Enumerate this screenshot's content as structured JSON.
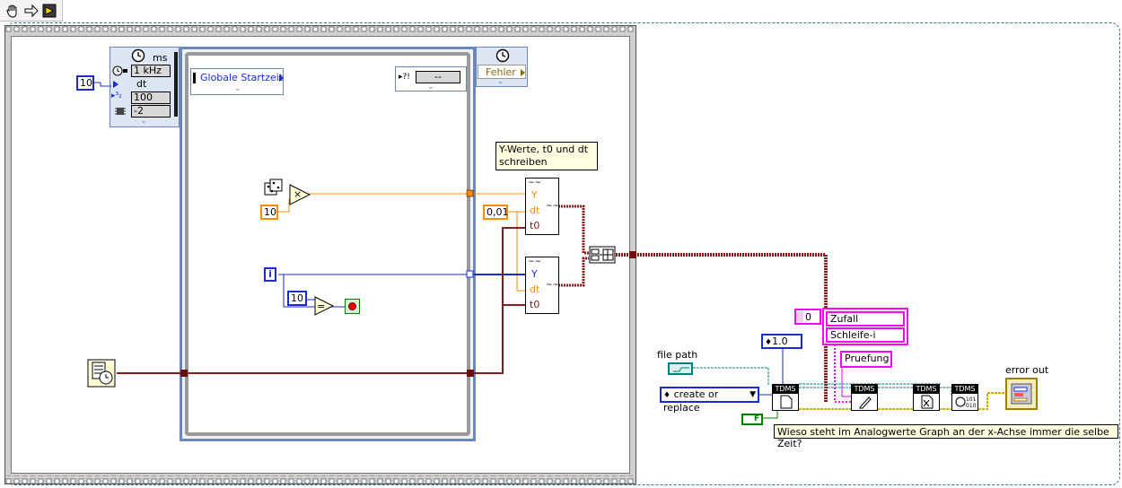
{
  "toolbar": {
    "icons": [
      "hand-icon",
      "arrow-icon",
      "probe-icon"
    ]
  },
  "timed_struct": {
    "unit": "ms",
    "source": "1 kHz",
    "dt_label": "dt",
    "dt_value": "10",
    "offset": "100",
    "processor": "-2"
  },
  "frames": {
    "global_start": "Globale Startzeit",
    "dash": "--",
    "error_label": "Fehler"
  },
  "constants": {
    "ten_mult": "10",
    "ten_compare": "10",
    "dt_const": "0,01",
    "zero_index": "0",
    "version": "1.0",
    "false_const": "F",
    "iteration": "i"
  },
  "waveform": {
    "y": "Y",
    "dt": "dt",
    "t0": "t0"
  },
  "channels": [
    "Zufall",
    "Schleife-i"
  ],
  "group_name": "Pruefung",
  "file_path_label": "file path",
  "operation": "create or replace",
  "error_out_label": "error out",
  "tdms": {
    "open": "TDMS",
    "write": "TDMS",
    "close": "TDMS",
    "viewer": "TDMS"
  },
  "notes": {
    "write_note": "Y-Werte, t0 und dt schreiben",
    "question": "Wieso steht im Analogwerte Graph an der x-Achse immer die selbe Zeit?"
  },
  "colors": {
    "orange": "#ff8c00",
    "blue": "#1a2bd6",
    "wave": "#8b1a1a",
    "pink": "#ff00ff",
    "teal": "#008080",
    "yellow": "#c8b400",
    "frame_blue": "#6e86b8"
  }
}
